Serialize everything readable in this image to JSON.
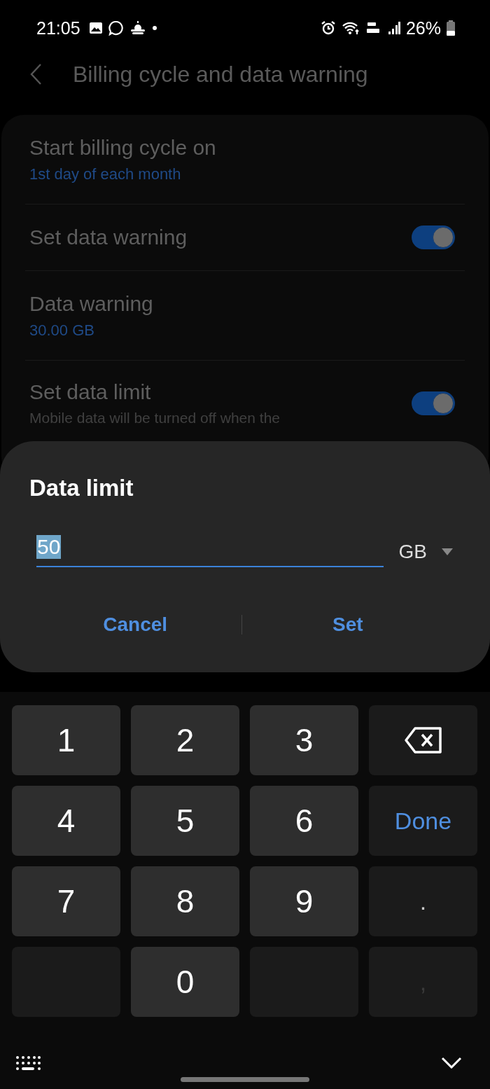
{
  "status_bar": {
    "time": "21:05",
    "battery": "26%"
  },
  "header": {
    "title": "Billing cycle and data warning"
  },
  "settings": [
    {
      "kind": "value",
      "title": "Start billing cycle on",
      "value": "1st day of each month"
    },
    {
      "kind": "switch",
      "title": "Set data warning",
      "on": true
    },
    {
      "kind": "value",
      "title": "Data warning",
      "value": "30.00 GB"
    },
    {
      "kind": "switch",
      "title": "Set data limit",
      "description": "Mobile data will be turned off when the",
      "on": true
    }
  ],
  "dialog": {
    "title": "Data limit",
    "value": "50",
    "unit": "GB",
    "buttons": [
      "Cancel",
      "Set"
    ]
  },
  "keypad": [
    {
      "kind": "digit",
      "label": "1"
    },
    {
      "kind": "digit",
      "label": "2"
    },
    {
      "kind": "digit",
      "label": "3"
    },
    {
      "kind": "backspace"
    },
    {
      "kind": "digit",
      "label": "4"
    },
    {
      "kind": "digit",
      "label": "5"
    },
    {
      "kind": "digit",
      "label": "6"
    },
    {
      "kind": "done",
      "label": "Done"
    },
    {
      "kind": "digit",
      "label": "7"
    },
    {
      "kind": "digit",
      "label": "8"
    },
    {
      "kind": "digit",
      "label": "9"
    },
    {
      "kind": "symbol",
      "label": "."
    },
    {
      "kind": "blank"
    },
    {
      "kind": "digit",
      "label": "0"
    },
    {
      "kind": "blank"
    },
    {
      "kind": "symbol",
      "label": ","
    }
  ]
}
